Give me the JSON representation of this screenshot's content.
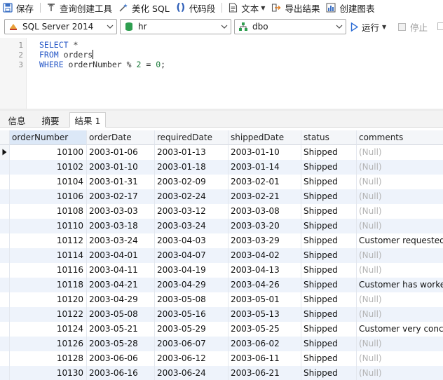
{
  "toolbar": {
    "save": "保存",
    "query_builder": "查询创建工具",
    "beautify": "美化 SQL",
    "snippet": "代码段",
    "text": "文本",
    "export": "导出结果",
    "create_chart": "创建图表"
  },
  "selectors": {
    "server": "SQL Server 2014",
    "database": "hr",
    "schema": "dbo",
    "run": "运行",
    "stop": "停止"
  },
  "editor": {
    "line_numbers": [
      "1",
      "2",
      "3"
    ],
    "line1_kw": "SELECT",
    "line1_rest": " *",
    "line2_kw": "FROM",
    "line2_rest": " orders",
    "line3_kw": "WHERE",
    "line3_a": " orderNumber % ",
    "line3_n1": "2",
    "line3_b": " = ",
    "line3_n2": "0",
    "line3_c": ";"
  },
  "tabs": [
    "信息",
    "摘要",
    "结果 1"
  ],
  "result": {
    "columns": [
      "orderNumber",
      "orderDate",
      "requiredDate",
      "shippedDate",
      "status",
      "comments"
    ],
    "rows": [
      [
        "10100",
        "2003-01-06",
        "2003-01-13",
        "2003-01-10",
        "Shipped",
        "(Null)"
      ],
      [
        "10102",
        "2003-01-10",
        "2003-01-18",
        "2003-01-14",
        "Shipped",
        "(Null)"
      ],
      [
        "10104",
        "2003-01-31",
        "2003-02-09",
        "2003-02-01",
        "Shipped",
        "(Null)"
      ],
      [
        "10106",
        "2003-02-17",
        "2003-02-24",
        "2003-02-21",
        "Shipped",
        "(Null)"
      ],
      [
        "10108",
        "2003-03-03",
        "2003-03-12",
        "2003-03-08",
        "Shipped",
        "(Null)"
      ],
      [
        "10110",
        "2003-03-18",
        "2003-03-24",
        "2003-03-20",
        "Shipped",
        "(Null)"
      ],
      [
        "10112",
        "2003-03-24",
        "2003-04-03",
        "2003-03-29",
        "Shipped",
        "Customer requested t"
      ],
      [
        "10114",
        "2003-04-01",
        "2003-04-07",
        "2003-04-02",
        "Shipped",
        "(Null)"
      ],
      [
        "10116",
        "2003-04-11",
        "2003-04-19",
        "2003-04-13",
        "Shipped",
        "(Null)"
      ],
      [
        "10118",
        "2003-04-21",
        "2003-04-29",
        "2003-04-26",
        "Shipped",
        "Customer has worked"
      ],
      [
        "10120",
        "2003-04-29",
        "2003-05-08",
        "2003-05-01",
        "Shipped",
        "(Null)"
      ],
      [
        "10122",
        "2003-05-08",
        "2003-05-16",
        "2003-05-13",
        "Shipped",
        "(Null)"
      ],
      [
        "10124",
        "2003-05-21",
        "2003-05-29",
        "2003-05-25",
        "Shipped",
        "Customer very concer"
      ],
      [
        "10126",
        "2003-05-28",
        "2003-06-07",
        "2003-06-02",
        "Shipped",
        "(Null)"
      ],
      [
        "10128",
        "2003-06-06",
        "2003-06-12",
        "2003-06-11",
        "Shipped",
        "(Null)"
      ],
      [
        "10130",
        "2003-06-16",
        "2003-06-24",
        "2003-06-21",
        "Shipped",
        "(Null)"
      ]
    ]
  },
  "colors": {
    "keyword": "#2456c6",
    "accent": "#1a73e8",
    "alt_row": "#eef3fb",
    "null_text": "#b3b3b3"
  }
}
